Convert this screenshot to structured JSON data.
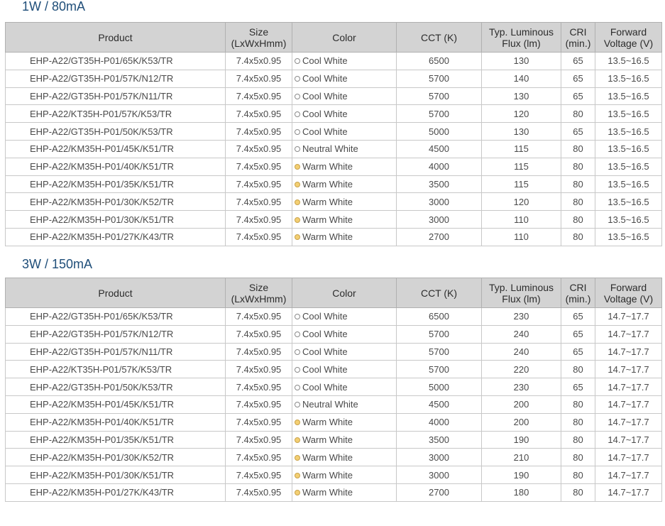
{
  "sections": [
    {
      "title": "1W / 80mA",
      "headers": {
        "product": "Product",
        "size": [
          "Size",
          "(LxWxHmm)"
        ],
        "color": "Color",
        "cct": "CCT (K)",
        "flux": [
          "Typ. Luminous",
          "Flux (lm)"
        ],
        "cri": [
          "CRI",
          "(min.)"
        ],
        "vf": [
          "Forward",
          "Voltage (V)"
        ]
      },
      "rows": [
        {
          "product": "EHP-A22/GT35H-P01/65K/K53/TR",
          "size": "7.4x5x0.95",
          "color": "Cool White",
          "cct": "6500",
          "flux": "130",
          "cri": "65",
          "vf": "13.5~16.5"
        },
        {
          "product": "EHP-A22/GT35H-P01/57K/N12/TR",
          "size": "7.4x5x0.95",
          "color": "Cool White",
          "cct": "5700",
          "flux": "140",
          "cri": "65",
          "vf": "13.5~16.5"
        },
        {
          "product": "EHP-A22/GT35H-P01/57K/N11/TR",
          "size": "7.4x5x0.95",
          "color": "Cool White",
          "cct": "5700",
          "flux": "130",
          "cri": "65",
          "vf": "13.5~16.5"
        },
        {
          "product": "EHP-A22/KT35H-P01/57K/K53/TR",
          "size": "7.4x5x0.95",
          "color": "Cool White",
          "cct": "5700",
          "flux": "120",
          "cri": "80",
          "vf": "13.5~16.5"
        },
        {
          "product": "EHP-A22/GT35H-P01/50K/K53/TR",
          "size": "7.4x5x0.95",
          "color": "Cool White",
          "cct": "5000",
          "flux": "130",
          "cri": "65",
          "vf": "13.5~16.5"
        },
        {
          "product": "EHP-A22/KM35H-P01/45K/K51/TR",
          "size": "7.4x5x0.95",
          "color": "Neutral White",
          "cct": "4500",
          "flux": "115",
          "cri": "80",
          "vf": "13.5~16.5"
        },
        {
          "product": "EHP-A22/KM35H-P01/40K/K51/TR",
          "size": "7.4x5x0.95",
          "color": "Warm White",
          "cct": "4000",
          "flux": "115",
          "cri": "80",
          "vf": "13.5~16.5"
        },
        {
          "product": "EHP-A22/KM35H-P01/35K/K51/TR",
          "size": "7.4x5x0.95",
          "color": "Warm White",
          "cct": "3500",
          "flux": "115",
          "cri": "80",
          "vf": "13.5~16.5"
        },
        {
          "product": "EHP-A22/KM35H-P01/30K/K52/TR",
          "size": "7.4x5x0.95",
          "color": "Warm White",
          "cct": "3000",
          "flux": "120",
          "cri": "80",
          "vf": "13.5~16.5"
        },
        {
          "product": "EHP-A22/KM35H-P01/30K/K51/TR",
          "size": "7.4x5x0.95",
          "color": "Warm White",
          "cct": "3000",
          "flux": "110",
          "cri": "80",
          "vf": "13.5~16.5"
        },
        {
          "product": "EHP-A22/KM35H-P01/27K/K43/TR",
          "size": "7.4x5x0.95",
          "color": "Warm White",
          "cct": "2700",
          "flux": "110",
          "cri": "80",
          "vf": "13.5~16.5"
        }
      ]
    },
    {
      "title": "3W / 150mA",
      "headers": {
        "product": "Product",
        "size": [
          "Size",
          "(LxWxHmm)"
        ],
        "color": "Color",
        "cct": "CCT (K)",
        "flux": [
          "Typ. Luminous",
          "Flux (lm)"
        ],
        "cri": [
          "CRI",
          "(min.)"
        ],
        "vf": [
          "Forward",
          "Voltage (V)"
        ]
      },
      "rows": [
        {
          "product": "EHP-A22/GT35H-P01/65K/K53/TR",
          "size": "7.4x5x0.95",
          "color": "Cool White",
          "cct": "6500",
          "flux": "230",
          "cri": "65",
          "vf": "14.7~17.7"
        },
        {
          "product": "EHP-A22/GT35H-P01/57K/N12/TR",
          "size": "7.4x5x0.95",
          "color": "Cool White",
          "cct": "5700",
          "flux": "240",
          "cri": "65",
          "vf": "14.7~17.7"
        },
        {
          "product": "EHP-A22/GT35H-P01/57K/N11/TR",
          "size": "7.4x5x0.95",
          "color": "Cool White",
          "cct": "5700",
          "flux": "240",
          "cri": "65",
          "vf": "14.7~17.7"
        },
        {
          "product": "EHP-A22/KT35H-P01/57K/K53/TR",
          "size": "7.4x5x0.95",
          "color": "Cool White",
          "cct": "5700",
          "flux": "220",
          "cri": "80",
          "vf": "14.7~17.7"
        },
        {
          "product": "EHP-A22/GT35H-P01/50K/K53/TR",
          "size": "7.4x5x0.95",
          "color": "Cool White",
          "cct": "5000",
          "flux": "230",
          "cri": "65",
          "vf": "14.7~17.7"
        },
        {
          "product": "EHP-A22/KM35H-P01/45K/K51/TR",
          "size": "7.4x5x0.95",
          "color": "Neutral White",
          "cct": "4500",
          "flux": "200",
          "cri": "80",
          "vf": "14.7~17.7"
        },
        {
          "product": "EHP-A22/KM35H-P01/40K/K51/TR",
          "size": "7.4x5x0.95",
          "color": "Warm White",
          "cct": "4000",
          "flux": "200",
          "cri": "80",
          "vf": "14.7~17.7"
        },
        {
          "product": "EHP-A22/KM35H-P01/35K/K51/TR",
          "size": "7.4x5x0.95",
          "color": "Warm White",
          "cct": "3500",
          "flux": "190",
          "cri": "80",
          "vf": "14.7~17.7"
        },
        {
          "product": "EHP-A22/KM35H-P01/30K/K52/TR",
          "size": "7.4x5x0.95",
          "color": "Warm White",
          "cct": "3000",
          "flux": "210",
          "cri": "80",
          "vf": "14.7~17.7"
        },
        {
          "product": "EHP-A22/KM35H-P01/30K/K51/TR",
          "size": "7.4x5x0.95",
          "color": "Warm White",
          "cct": "3000",
          "flux": "190",
          "cri": "80",
          "vf": "14.7~17.7"
        },
        {
          "product": "EHP-A22/KM35H-P01/27K/K43/TR",
          "size": "7.4x5x0.95",
          "color": "Warm White",
          "cct": "2700",
          "flux": "180",
          "cri": "80",
          "vf": "14.7~17.7"
        }
      ]
    }
  ],
  "colors": {
    "title": "#1f4e79",
    "header_bg": "#d3d3d3",
    "warm_dot": "#f3cf73",
    "cool_dot": "#ffffff"
  }
}
